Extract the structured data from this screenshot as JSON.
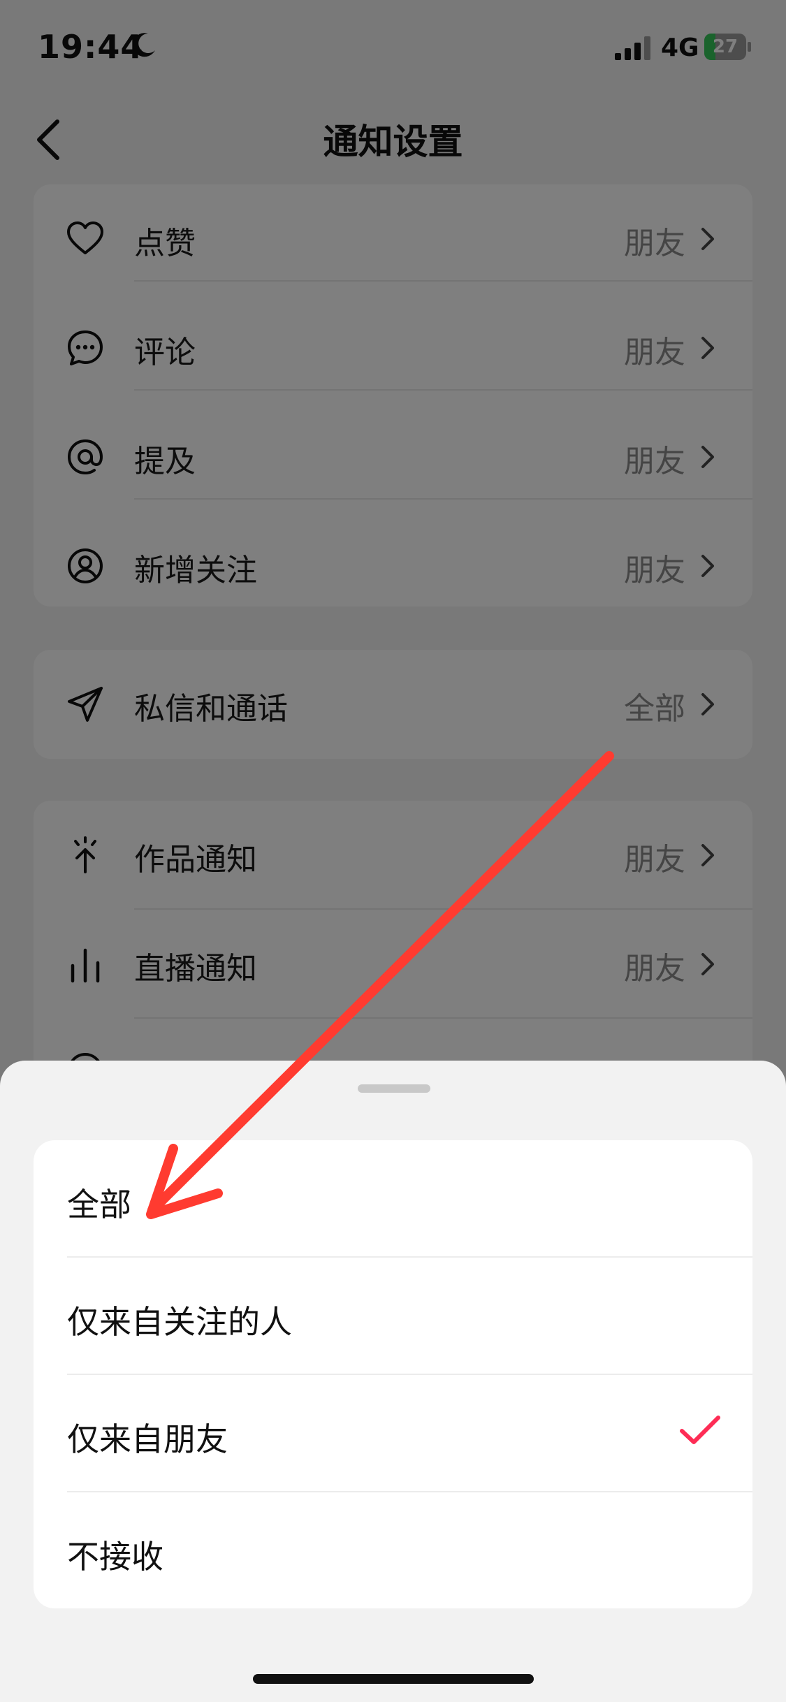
{
  "status_bar": {
    "time": "19:44",
    "network": "4G",
    "battery": "27",
    "battery_level": 0.27
  },
  "nav": {
    "title": "通知设置"
  },
  "sections": [
    {
      "items": [
        {
          "label": "点赞",
          "value": "朋友",
          "icon": "heart-icon"
        },
        {
          "label": "评论",
          "value": "朋友",
          "icon": "comment-bubble-icon"
        },
        {
          "label": "提及",
          "value": "朋友",
          "icon": "at-icon"
        },
        {
          "label": "新增关注",
          "value": "朋友",
          "icon": "user-circle-icon"
        }
      ]
    },
    {
      "items": [
        {
          "label": "私信和通话",
          "value": "全部",
          "icon": "paper-plane-icon"
        }
      ]
    },
    {
      "items": [
        {
          "label": "作品通知",
          "value": "朋友",
          "icon": "sparkle-arrow-icon"
        },
        {
          "label": "直播通知",
          "value": "朋友",
          "icon": "bars-icon"
        }
      ]
    }
  ],
  "sheet": {
    "options": [
      {
        "label": "全部",
        "selected": false
      },
      {
        "label": "仅来自关注的人",
        "selected": false
      },
      {
        "label": "仅来自朋友",
        "selected": true
      },
      {
        "label": "不接收",
        "selected": false
      }
    ]
  },
  "colors": {
    "accent": "#fe2c55",
    "annotation_arrow": "#ff3b30",
    "battery_green": "#34c759"
  }
}
